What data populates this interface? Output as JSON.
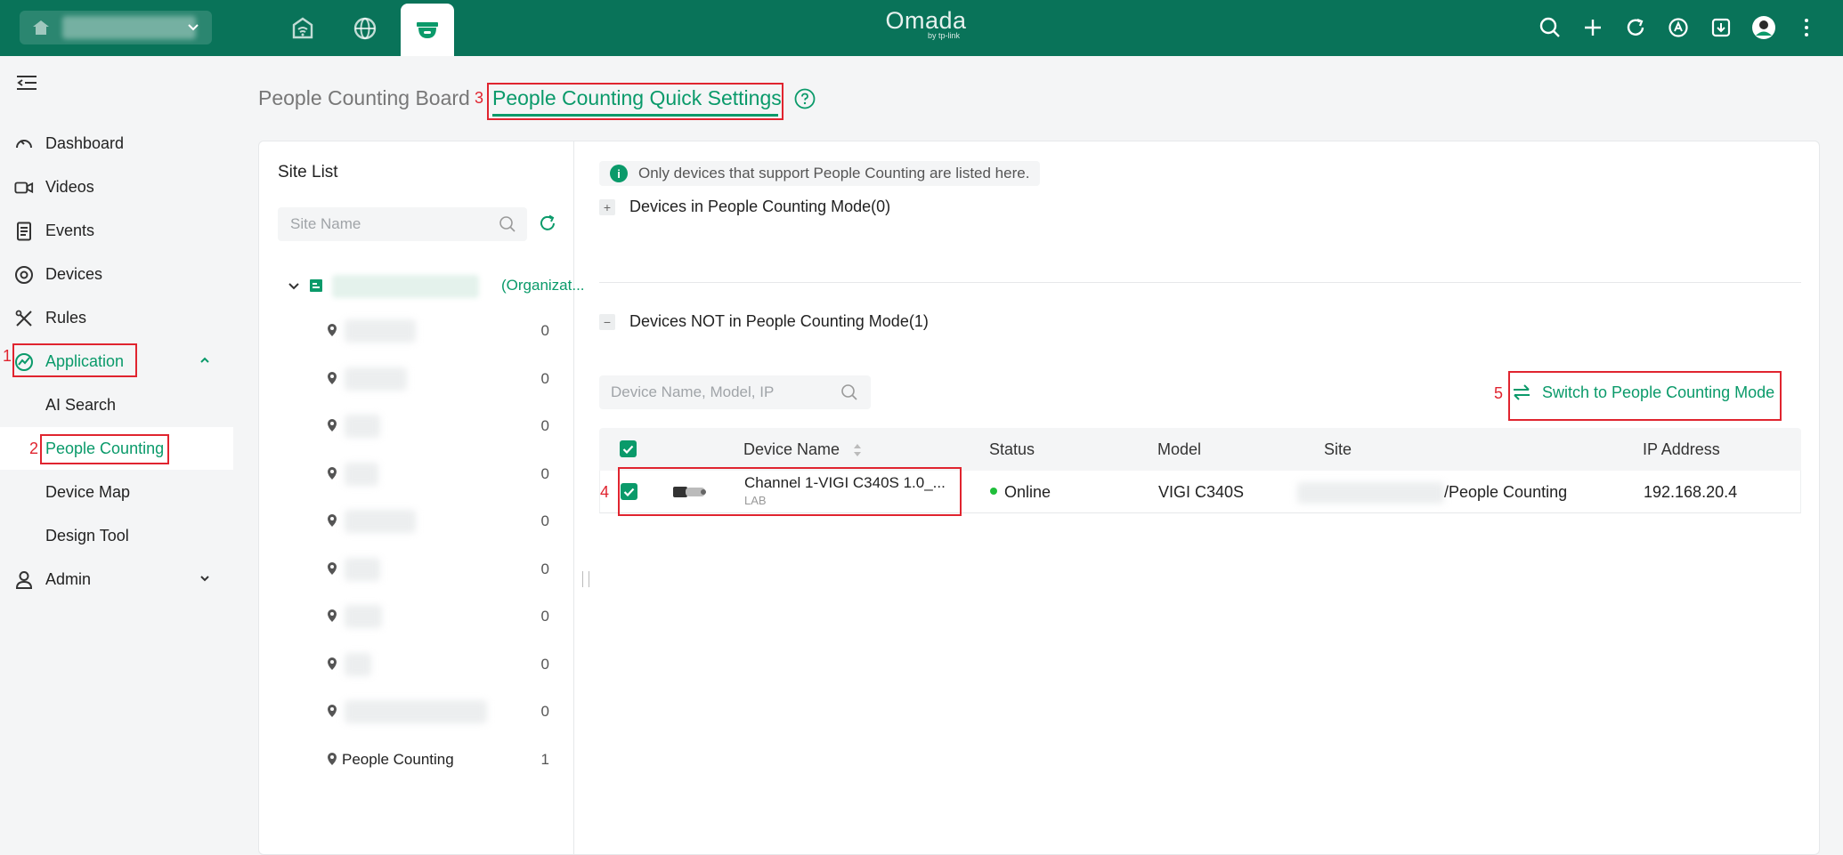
{
  "brand": {
    "name": "Omada",
    "byline": "by tp-link"
  },
  "colors": {
    "topbar": "#097359",
    "accent": "#0a9a6a",
    "annotation": "#e0242f",
    "online": "#1fbe3a"
  },
  "topbar": {
    "site_selector_icon": "home-icon",
    "tabs": [
      {
        "name": "network-tab",
        "icon": "wifi-router-icon"
      },
      {
        "name": "cloud-tab",
        "icon": "globe-icon"
      },
      {
        "name": "surveillance-tab",
        "icon": "camera-dome-icon",
        "active": true
      }
    ],
    "actions": [
      "search-icon",
      "plus-icon",
      "refresh-icon",
      "app-icon",
      "download-icon",
      "avatar-icon",
      "more-vertical-icon"
    ]
  },
  "sidebar": {
    "items": [
      {
        "label": "Dashboard",
        "icon": "dashboard-icon"
      },
      {
        "label": "Videos",
        "icon": "video-icon"
      },
      {
        "label": "Events",
        "icon": "events-icon"
      },
      {
        "label": "Devices",
        "icon": "devices-icon"
      },
      {
        "label": "Rules",
        "icon": "rules-icon"
      },
      {
        "label": "Application",
        "icon": "application-icon",
        "active": true,
        "expanded": true
      },
      {
        "label": "AI Search",
        "sub": true
      },
      {
        "label": "People Counting",
        "sub": true,
        "active": true
      },
      {
        "label": "Device Map",
        "sub": true
      },
      {
        "label": "Design Tool",
        "sub": true
      },
      {
        "label": "Admin",
        "icon": "admin-icon"
      }
    ]
  },
  "annotations": [
    "1",
    "2",
    "3",
    "4",
    "5"
  ],
  "page": {
    "tabs": [
      {
        "label": "People Counting Board",
        "active": false
      },
      {
        "label": "People Counting Quick Settings",
        "active": true
      }
    ]
  },
  "site_list": {
    "title": "Site List",
    "search_placeholder": "Site Name",
    "org_label": "(Organizat...",
    "sites": [
      {
        "name": "",
        "count": "0"
      },
      {
        "name": "",
        "count": "0"
      },
      {
        "name": "",
        "count": "0"
      },
      {
        "name": "",
        "count": "0"
      },
      {
        "name": "",
        "count": "0"
      },
      {
        "name": "",
        "count": "0"
      },
      {
        "name": "",
        "count": "0"
      },
      {
        "name": "",
        "count": "0"
      },
      {
        "name": "",
        "count": "0"
      },
      {
        "name": "People Counting",
        "count": "1"
      }
    ]
  },
  "main": {
    "notice": "Only devices that support People Counting are listed here.",
    "in_mode_header": "Devices in People Counting Mode(0)",
    "in_mode_toggle": "+",
    "not_in_mode_header": "Devices NOT in People Counting Mode(1)",
    "not_in_mode_toggle": "−",
    "search_placeholder": "Device Name, Model, IP",
    "switch_button": "Switch to People Counting Mode",
    "table": {
      "columns": [
        "Device Name",
        "Status",
        "Model",
        "Site",
        "IP Address"
      ],
      "rows": [
        {
          "device_name": "Channel 1-VIGI C340S 1.0_...",
          "device_sub": "LAB",
          "status": "Online",
          "model": "VIGI C340S",
          "site": "/People Counting",
          "ip": "192.168.20.4",
          "checked": true
        }
      ]
    }
  }
}
